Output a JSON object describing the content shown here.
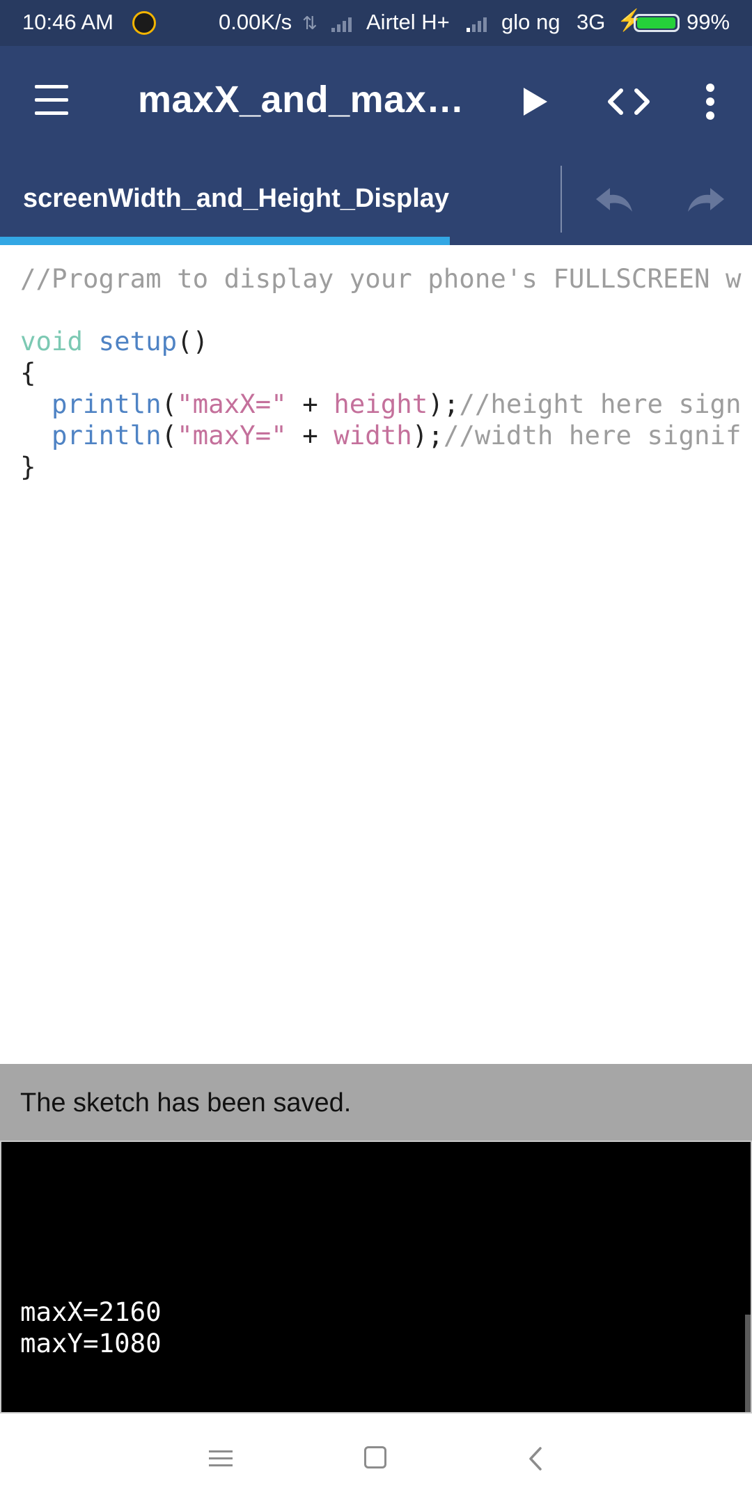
{
  "status_bar": {
    "time": "10:46 AM",
    "speed": "0.00K/s",
    "carrier1": "Airtel H+",
    "carrier2": "glo ng",
    "network2": "3G",
    "battery_percent": "99%",
    "battery_level": 0.99,
    "colors": {
      "background": "#283a60",
      "battery_fill": "#25d13a"
    }
  },
  "toolbar": {
    "title": "maxX_and_maxY…",
    "icons": {
      "menu": "hamburger-menu-icon",
      "run": "play-icon",
      "code": "code-brackets-icon",
      "more": "more-vertical-icon"
    },
    "colors": {
      "background": "#2e4371"
    }
  },
  "tabs": [
    {
      "label": "screenWidth_and_Height_Display",
      "selected": true
    }
  ],
  "tab_actions": {
    "undo_icon": "undo-icon",
    "redo_icon": "redo-icon",
    "indicator_color": "#33a7e4"
  },
  "editor": {
    "lines": [
      [
        {
          "t": "//Program to display your phone's FULLSCREEN w",
          "c": "comment"
        }
      ],
      [],
      [
        {
          "t": "void",
          "c": "kw"
        },
        {
          "t": " ",
          "c": "pl"
        },
        {
          "t": "setup",
          "c": "fn"
        },
        {
          "t": "()",
          "c": "pl"
        }
      ],
      [
        {
          "t": "{",
          "c": "pl"
        }
      ],
      [
        {
          "t": "  ",
          "c": "pl"
        },
        {
          "t": "println",
          "c": "fn"
        },
        {
          "t": "(",
          "c": "pl"
        },
        {
          "t": "\"maxX=\"",
          "c": "str"
        },
        {
          "t": " + ",
          "c": "pl"
        },
        {
          "t": "height",
          "c": "var"
        },
        {
          "t": ");",
          "c": "pl"
        },
        {
          "t": "//height here sign",
          "c": "comment"
        }
      ],
      [
        {
          "t": "  ",
          "c": "pl"
        },
        {
          "t": "println",
          "c": "fn"
        },
        {
          "t": "(",
          "c": "pl"
        },
        {
          "t": "\"maxY=\"",
          "c": "str"
        },
        {
          "t": " + ",
          "c": "pl"
        },
        {
          "t": "width",
          "c": "var"
        },
        {
          "t": ");",
          "c": "pl"
        },
        {
          "t": "//width here signif",
          "c": "comment"
        }
      ],
      [
        {
          "t": "}",
          "c": "pl"
        }
      ]
    ],
    "colors": {
      "comment": "#9d9d9d",
      "keyword": "#7cc9b3",
      "function": "#4f83c4",
      "string": "#c4709b"
    }
  },
  "message": {
    "text": "The sketch has been saved.",
    "background": "#a6a6a6"
  },
  "console": {
    "lines": [
      "maxX=2160",
      "maxY=1080"
    ],
    "background": "#000000"
  },
  "nav_bar": {
    "icons": {
      "menu": "nav-menu-icon",
      "home": "nav-home-icon",
      "back": "nav-back-icon"
    }
  }
}
